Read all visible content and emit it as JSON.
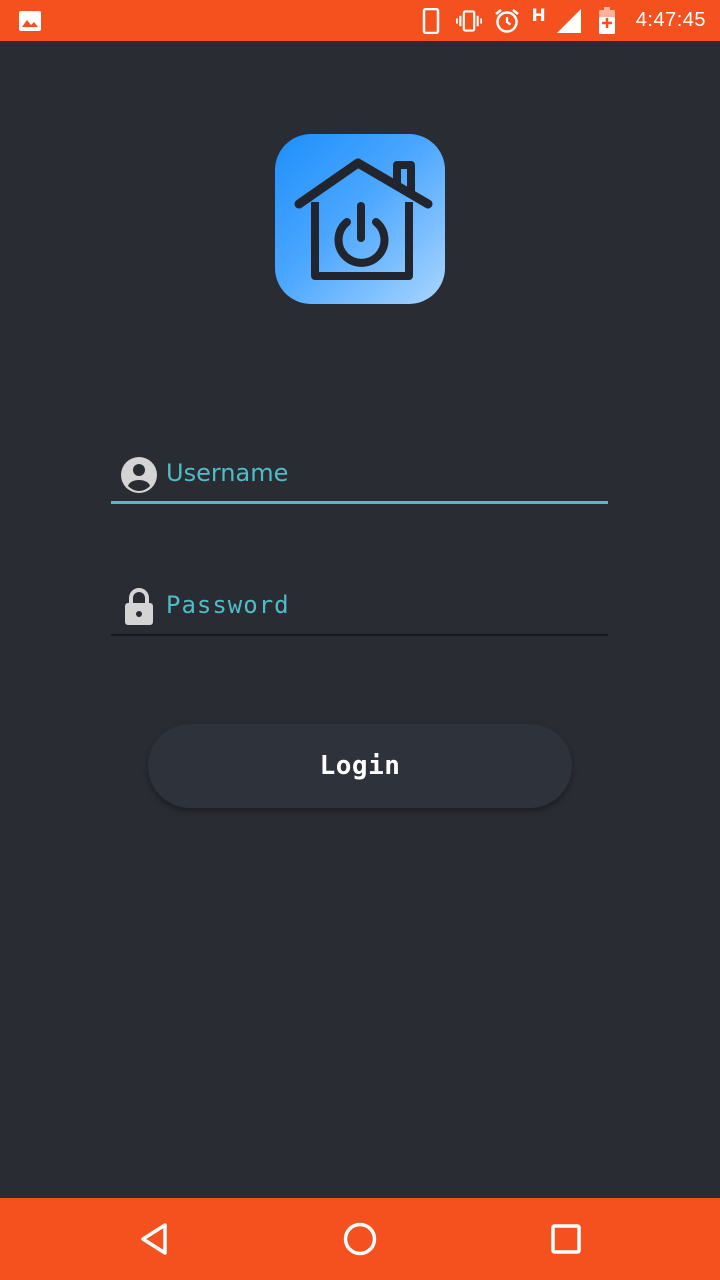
{
  "status_bar": {
    "time": "4:47:45",
    "network_type": "H",
    "icons": [
      "image-notification-icon",
      "phone-icon",
      "vibrate-icon",
      "alarm-icon",
      "signal-icon",
      "battery-charging-icon"
    ]
  },
  "app": {
    "logo_icon": "home-power-icon"
  },
  "login_form": {
    "username_placeholder": "Username",
    "username_icon": "account-circle-icon",
    "password_placeholder": "Password",
    "password_icon": "lock-icon",
    "login_label": "Login"
  },
  "nav_bar": {
    "icons": [
      "back-icon",
      "home-icon",
      "recents-icon"
    ]
  },
  "colors": {
    "accent": "#f4511e",
    "background": "#2a2c34",
    "input_text": "#4fbcc6",
    "button": "#2e323a",
    "logo_gradient_start": "#1e8ffc",
    "logo_gradient_end": "#a9d6ff"
  }
}
